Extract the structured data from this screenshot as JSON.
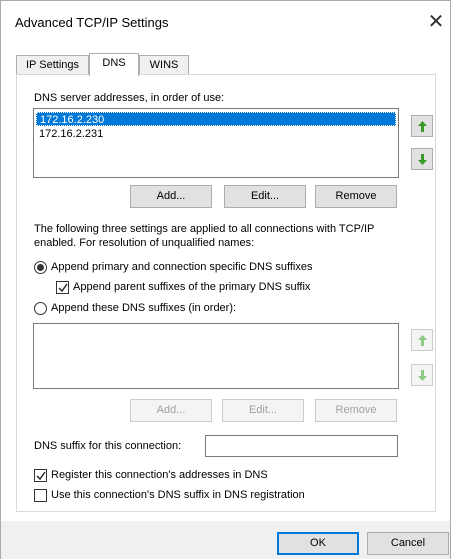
{
  "window": {
    "title": "Advanced TCP/IP Settings",
    "close_glyph": "✕"
  },
  "tabs": [
    {
      "label": "IP Settings",
      "active": false
    },
    {
      "label": "DNS",
      "active": true
    },
    {
      "label": "WINS",
      "active": false
    }
  ],
  "dns": {
    "servers_label": "DNS server addresses, in order of use:",
    "servers": [
      {
        "value": "172.16.2.230",
        "selected": true
      },
      {
        "value": "172.16.2.231",
        "selected": false
      }
    ],
    "buttons": {
      "add": "Add...",
      "edit": "Edit...",
      "remove": "Remove"
    },
    "info_text_line1": "The following three settings are applied to all connections with TCP/IP",
    "info_text_line2": "enabled. For resolution of unqualified names:",
    "radio_primary_label": "Append primary and connection specific DNS suffixes",
    "radio_primary_checked": true,
    "check_parent_label": "Append parent suffixes of the primary DNS suffix",
    "check_parent_checked": true,
    "radio_these_label": "Append these DNS suffixes (in order):",
    "radio_these_checked": false,
    "suffix_buttons": {
      "add": "Add...",
      "edit": "Edit...",
      "remove": "Remove"
    },
    "suffix_label": "DNS suffix for this connection:",
    "suffix_value": "",
    "register_label": "Register this connection's addresses in DNS",
    "register_checked": true,
    "use_suffix_label": "Use this connection's DNS suffix in DNS registration",
    "use_suffix_checked": false
  },
  "footer": {
    "ok": "OK",
    "cancel": "Cancel"
  },
  "colors": {
    "selection": "#0078d7",
    "arrow_green": "#3a9a2a",
    "arrow_green_disabled": "#8fc986"
  },
  "icons": {
    "up": "arrow-up-icon",
    "down": "arrow-down-icon"
  }
}
